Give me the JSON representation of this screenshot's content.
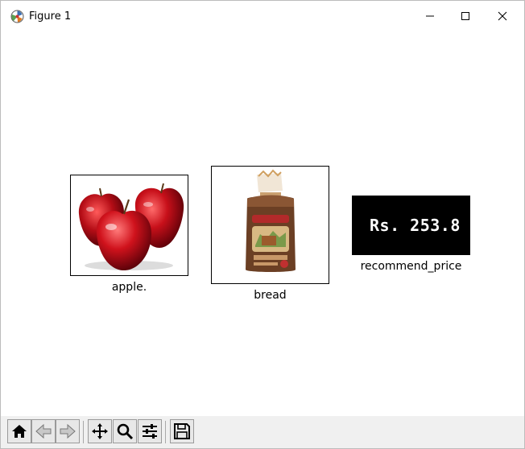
{
  "window": {
    "title": "Figure 1",
    "controls": [
      "minimize",
      "maximize",
      "close"
    ]
  },
  "figure": {
    "panels": [
      {
        "image": "apple-photo",
        "caption": "apple."
      },
      {
        "image": "bread-loaf-photo",
        "caption": "bread"
      },
      {
        "image": "price-display",
        "text": "Rs. 253.8",
        "caption": "recommend_price"
      }
    ]
  },
  "toolbar": {
    "buttons": [
      "home",
      "back",
      "forward",
      "pan",
      "zoom",
      "configure-subplots",
      "save"
    ]
  }
}
